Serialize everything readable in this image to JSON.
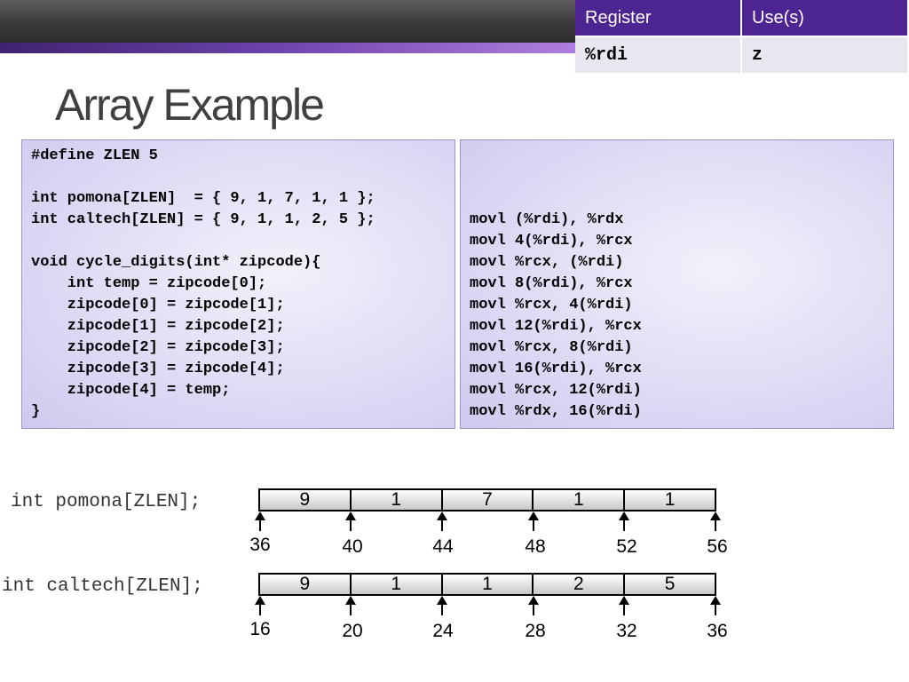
{
  "slide": {
    "title": "Array Example"
  },
  "register_table": {
    "headers": [
      "Register",
      "Use(s)"
    ],
    "rows": [
      [
        "%rdi",
        "z"
      ]
    ]
  },
  "c_code": "#define ZLEN 5\n\nint pomona[ZLEN]  = { 9, 1, 7, 1, 1 };\nint caltech[ZLEN] = { 9, 1, 1, 2, 5 };\n\nvoid cycle_digits(int* zipcode){\n    int temp = zipcode[0];\n    zipcode[0] = zipcode[1];\n    zipcode[1] = zipcode[2];\n    zipcode[2] = zipcode[3];\n    zipcode[3] = zipcode[4];\n    zipcode[4] = temp;\n}",
  "asm_code": "movl (%rdi), %rdx\nmovl 4(%rdi), %rcx\nmovl %rcx, (%rdi)\nmovl 8(%rdi), %rcx\nmovl %rcx, 4(%rdi)\nmovl 12(%rdi), %rcx\nmovl %rcx, 8(%rdi)\nmovl 16(%rdi), %rcx\nmovl %rcx, 12(%rdi)\nmovl %rdx, 16(%rdi)",
  "arrays": [
    {
      "label": "int pomona[ZLEN];",
      "values": [
        "9",
        "1",
        "7",
        "1",
        "1"
      ],
      "addresses": [
        "36",
        "40",
        "44",
        "48",
        "52",
        "56"
      ]
    },
    {
      "label": "int caltech[ZLEN];",
      "values": [
        "9",
        "1",
        "1",
        "2",
        "5"
      ],
      "addresses": [
        "16",
        "20",
        "24",
        "28",
        "32",
        "36"
      ]
    }
  ]
}
